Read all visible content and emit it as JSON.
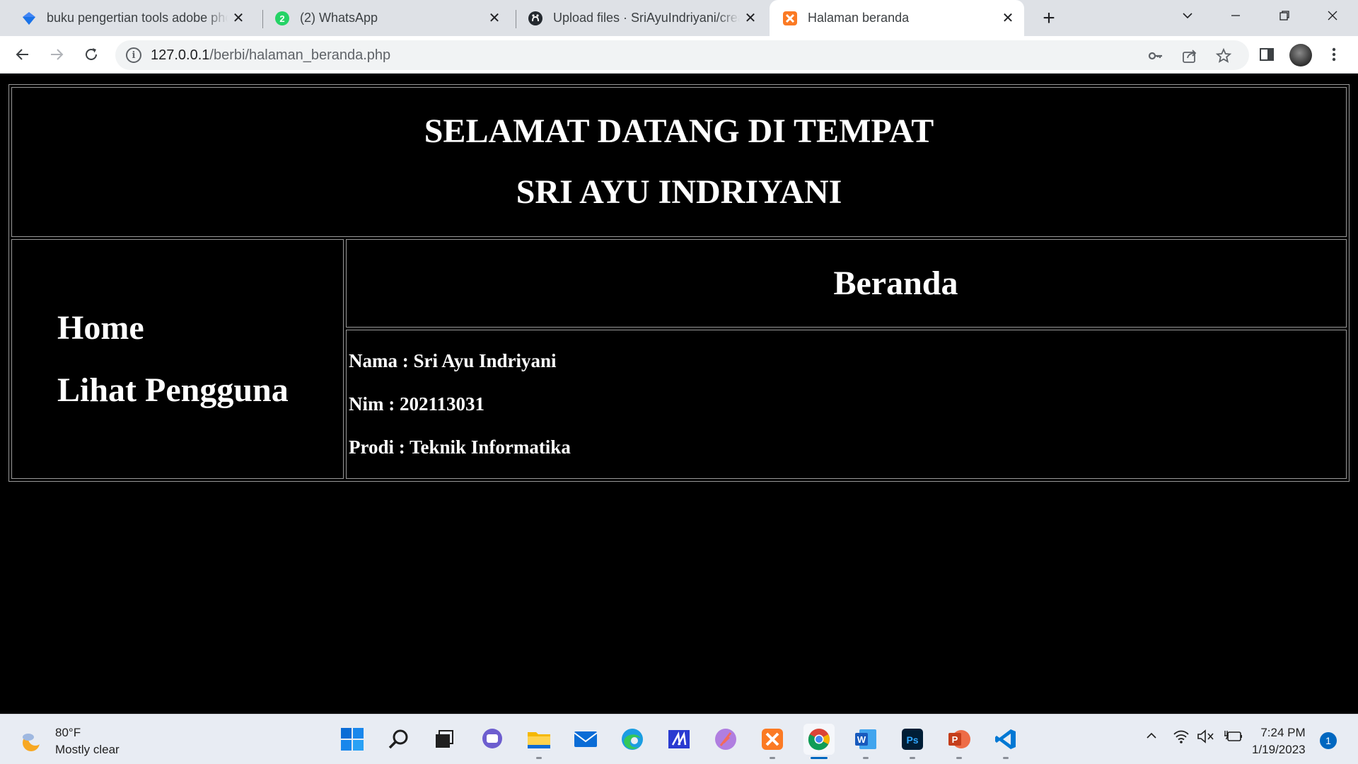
{
  "browser": {
    "tabs": [
      {
        "title": "buku pengertian tools adobe photoshop",
        "favicon": "diamond-icon"
      },
      {
        "title": "(2) WhatsApp",
        "favicon": "whatsapp-icon"
      },
      {
        "title": "Upload files · SriAyuIndriyani/create",
        "favicon": "github-icon"
      },
      {
        "title": "Halaman beranda",
        "favicon": "xampp-icon",
        "active": true
      }
    ],
    "url_host": "127.0.0.1",
    "url_path": "/berbi/halaman_beranda.php"
  },
  "page": {
    "heading_line1": "SELAMAT DATANG DI TEMPAT",
    "heading_line2": "SRI AYU INDRIYANI",
    "menu": [
      {
        "label": "Home"
      },
      {
        "label": "Lihat Pengguna"
      }
    ],
    "section_title": "Beranda",
    "info": [
      {
        "text": "Nama : Sri Ayu Indriyani"
      },
      {
        "text": "Nim : 202113031"
      },
      {
        "text": "Prodi : Teknik Informatika"
      }
    ]
  },
  "taskbar": {
    "weather_temp": "80°F",
    "weather_desc": "Mostly clear",
    "time": "7:24 PM",
    "date": "1/19/2023",
    "notification_count": "1"
  },
  "colors": {
    "page_bg": "#000000",
    "page_text": "#ffffff",
    "chrome_bg": "#dee1e6",
    "accent": "#0067c0"
  }
}
